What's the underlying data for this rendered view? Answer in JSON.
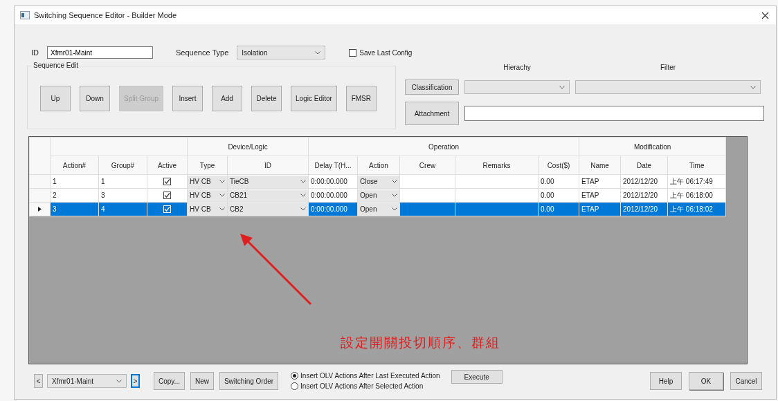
{
  "window": {
    "title": "Switching Sequence Editor - Builder Mode"
  },
  "id_field": {
    "label": "ID",
    "value": "Xfmr01-Maint"
  },
  "sequence_type": {
    "label": "Sequence Type",
    "value": "Isolation"
  },
  "save_last_config": {
    "label": "Save Last Config",
    "checked": false
  },
  "sequence_edit": {
    "title": "Sequence Edit",
    "buttons": [
      {
        "label": "Up",
        "disabled": false
      },
      {
        "label": "Down",
        "disabled": false
      },
      {
        "label": "Split Group",
        "disabled": true
      },
      {
        "label": "Insert",
        "disabled": false
      },
      {
        "label": "Add",
        "disabled": false
      },
      {
        "label": "Delete",
        "disabled": false
      },
      {
        "label": "Logic Editor",
        "disabled": false
      },
      {
        "label": "FMSR",
        "disabled": false
      }
    ]
  },
  "classification": {
    "button": "Classification",
    "hierachy_label": "Hierachy",
    "filter_label": "Filter"
  },
  "attachment": {
    "button": "Attachment"
  },
  "grid": {
    "groups": [
      {
        "columns": [
          "Action#",
          "Group#",
          "Active"
        ]
      },
      {
        "label": "Device/Logic",
        "columns": [
          "Type",
          "ID"
        ]
      },
      {
        "label": "Operation",
        "columns": [
          "Delay T(H...",
          "Action",
          "Crew",
          "Remarks",
          "Cost($)"
        ]
      },
      {
        "label": "Modification",
        "columns": [
          "Name",
          "Date",
          "Time"
        ]
      }
    ],
    "rows": [
      {
        "selected": false,
        "action_no": "1",
        "group_no": "1",
        "active": true,
        "type": "HV CB",
        "id": "TieCB",
        "delay": "0:00:00.000",
        "action": "Close",
        "cost": "0.00",
        "name": "ETAP",
        "date": "2012/12/20",
        "time": "上午 06:17:49"
      },
      {
        "selected": false,
        "action_no": "2",
        "group_no": "3",
        "active": true,
        "type": "HV CB",
        "id": "CB21",
        "delay": "0:00:00.000",
        "action": "Open",
        "cost": "0.00",
        "name": "ETAP",
        "date": "2012/12/20",
        "time": "上午 06:18:00"
      },
      {
        "selected": true,
        "action_no": "3",
        "group_no": "4",
        "active": true,
        "type": "HV CB",
        "id": "CB2",
        "delay": "0:00:00.000",
        "action": "Open",
        "cost": "0.00",
        "name": "ETAP",
        "date": "2012/12/20",
        "time": "上午 06:18:02"
      }
    ]
  },
  "annotation": {
    "text": "設定開關投切順序、群組"
  },
  "bottom": {
    "prev": "<",
    "sequence": "Xfmr01-Maint",
    "next": ">",
    "buttons": [
      "Copy...",
      "New",
      "Switching Order"
    ],
    "insert_options": [
      {
        "label": "Insert OLV Actions After Last Executed Action",
        "selected": true
      },
      {
        "label": "Insert OLV Actions After Selected Action",
        "selected": false
      }
    ],
    "execute": "Execute",
    "help": "Help",
    "ok": "OK",
    "cancel": "Cancel"
  }
}
